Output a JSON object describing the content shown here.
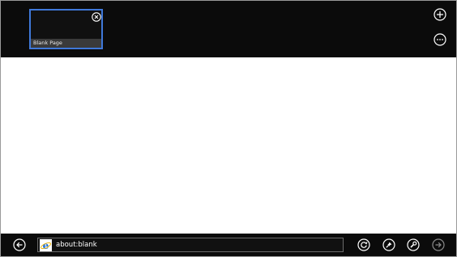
{
  "tabs": {
    "items": [
      {
        "label": "Blank Page",
        "active": true
      }
    ]
  },
  "address_bar": {
    "url": "about:blank"
  },
  "icons": {
    "new_tab": "plus-circle-icon",
    "tab_tools": "more-circle-icon",
    "close_tab": "close-circle-icon",
    "back": "back-arrow-icon",
    "site_logo": "ie-logo-icon",
    "refresh": "refresh-icon",
    "pin": "pin-icon",
    "page_tools": "wrench-icon",
    "forward": "forward-arrow-icon"
  },
  "colors": {
    "bar_background": "#0b0b0b",
    "active_tab_border": "#3f78d9",
    "content_background": "#ffffff",
    "icon": "#ffffff",
    "disabled_icon": "#8a8a8a"
  }
}
